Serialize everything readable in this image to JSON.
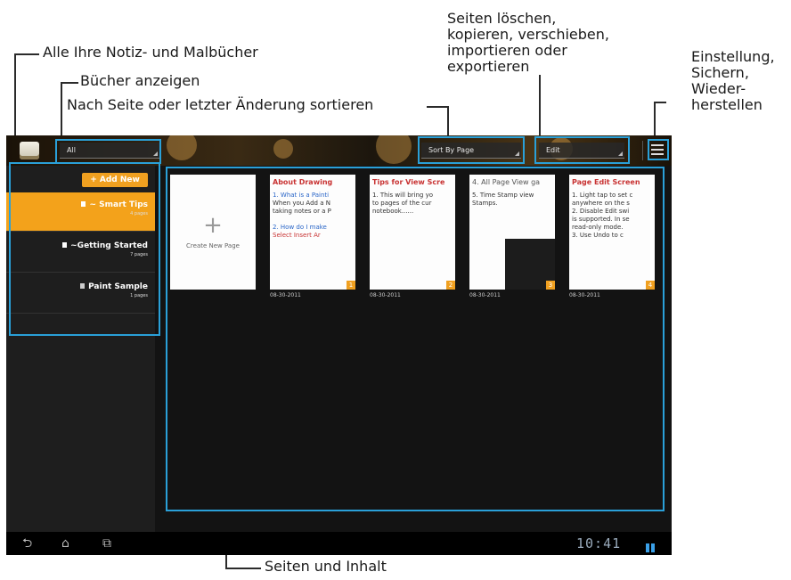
{
  "callouts": {
    "all_books": "Alle Ihre Notiz- und Malbücher",
    "show_books": "Bücher anzeigen",
    "sort": "Nach Seite oder letzter Änderung sortieren",
    "edit": "Seiten löschen,\nkopieren, verschieben,\nimportieren oder\nexportieren",
    "settings": "Einstellung,\nSichern,\nWieder-\nherstellen",
    "pages": "Seiten und Inhalt"
  },
  "toolbar": {
    "filter_value": "All",
    "sort_value": "Sort By Page",
    "edit_value": "Edit"
  },
  "sidebar": {
    "add_new": "+ Add New",
    "books": [
      {
        "title": "~ Smart Tips",
        "count": "4 pages",
        "selected": true
      },
      {
        "title": "~Getting Started",
        "count": "7 pages",
        "selected": false
      },
      {
        "title": "Paint Sample",
        "count": "1 pages",
        "selected": false
      }
    ]
  },
  "content": {
    "create_label": "Create New Page",
    "pages": [
      {
        "title": "About Drawing",
        "lines": [
          "1. What is a Painti",
          "When you Add a N",
          "taking notes or a P",
          "",
          "2. How do I make ",
          "Select Insert Ar"
        ],
        "number": "1",
        "date": "08-30-2011"
      },
      {
        "title": "Tips for View Scre",
        "lines": [
          "1. This will bring yo",
          "to pages of the cur",
          "notebook......"
        ],
        "number": "2",
        "date": "08-30-2011"
      },
      {
        "title": "4. All Page View ga",
        "lines": [
          "5. Time Stamp view",
          "Stamps."
        ],
        "number": "3",
        "date": "08-30-2011"
      },
      {
        "title": "Page Edit Screen",
        "lines": [
          "1. Light tap to set c",
          "anywhere on the s",
          "2. Disable Edit swi",
          "is supported. In se",
          "read-only mode.",
          "3. Use Undo to c"
        ],
        "number": "4",
        "date": "08-30-2011"
      }
    ]
  },
  "navbar": {
    "clock": "10:41",
    "icons": [
      "back-icon",
      "home-icon",
      "recent-apps-icon"
    ]
  },
  "colors": {
    "highlight": "#2aa0d8",
    "accent": "#f3a21b"
  }
}
